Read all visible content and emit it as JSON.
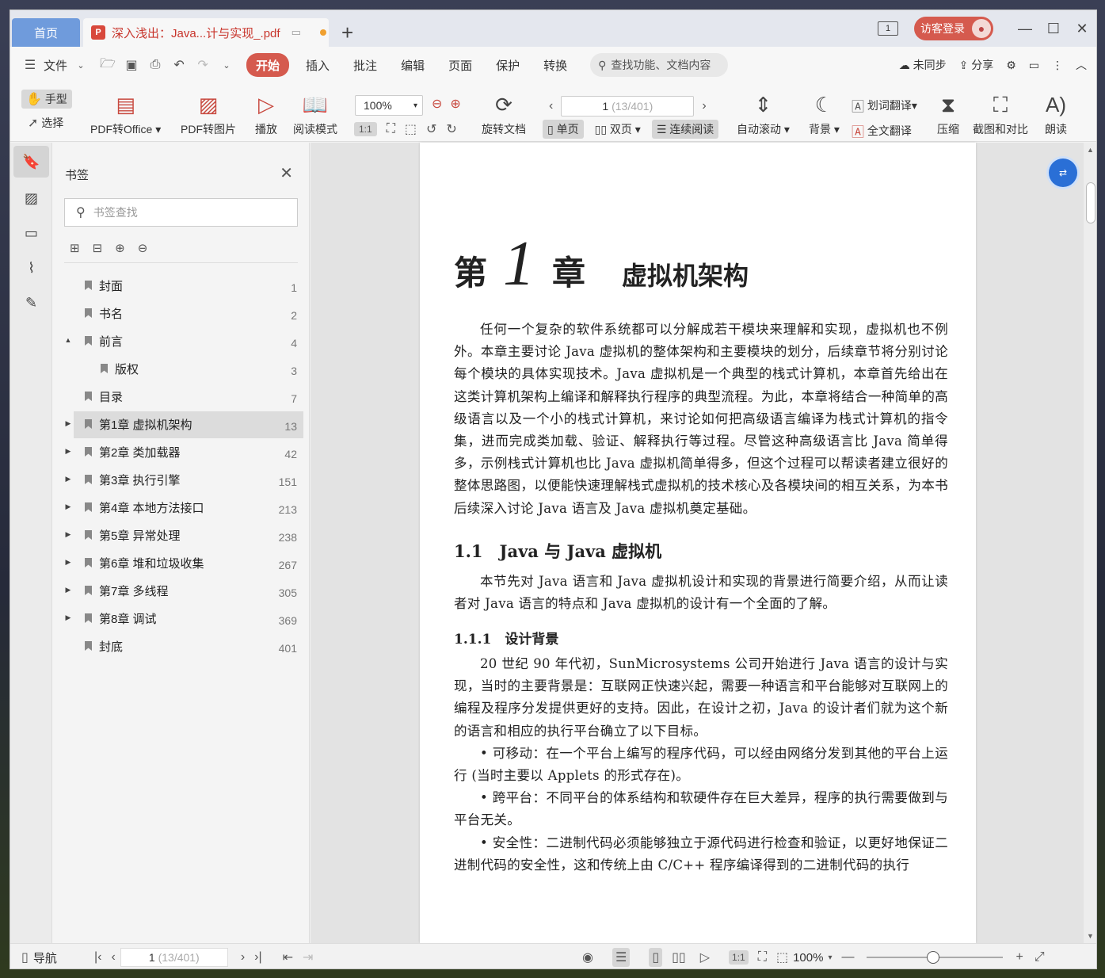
{
  "titlebar": {
    "home_tab": "首页",
    "doc_tab": "深入浅出：Java...计与实现_.pdf",
    "pdf_badge": "P",
    "add_tab": "+",
    "page_indicator": "1",
    "guest_login": "访客登录"
  },
  "menubar": {
    "file": "文件",
    "tabs": [
      "开始",
      "插入",
      "批注",
      "编辑",
      "页面",
      "保护",
      "转换"
    ],
    "search_placeholder": "查找功能、文档内容",
    "sync": "未同步",
    "share": "分享"
  },
  "ribbon": {
    "hand": "手型",
    "select": "选择",
    "pdf_to_office": "PDF转Office",
    "pdf_to_image": "PDF转图片",
    "play": "播放",
    "read_mode": "阅读模式",
    "zoom": "100%",
    "rotate_doc": "旋转文档",
    "page_current": "1",
    "page_total": "(13/401)",
    "single_page": "单页",
    "double_page": "双页",
    "continuous": "连续阅读",
    "auto_scroll": "自动滚动",
    "background": "背景",
    "word_translate": "划词翻译",
    "full_translate": "全文翻译",
    "compress": "压缩",
    "screenshot_compare": "截图和对比",
    "read_aloud": "朗读"
  },
  "bookmarks": {
    "title": "书签",
    "search_placeholder": "书签查找",
    "items": [
      {
        "label": "封面",
        "page": "1"
      },
      {
        "label": "书名",
        "page": "2"
      },
      {
        "label": "前言",
        "page": "4"
      },
      {
        "label": "版权",
        "page": "3"
      },
      {
        "label": "目录",
        "page": "7"
      },
      {
        "label": "第1章 虚拟机架构",
        "page": "13"
      },
      {
        "label": "第2章 类加载器",
        "page": "42"
      },
      {
        "label": "第3章 执行引擎",
        "page": "151"
      },
      {
        "label": "第4章 本地方法接口",
        "page": "213"
      },
      {
        "label": "第5章 异常处理",
        "page": "238"
      },
      {
        "label": "第6章 堆和垃圾收集",
        "page": "267"
      },
      {
        "label": "第7章 多线程",
        "page": "305"
      },
      {
        "label": "第8章 调试",
        "page": "369"
      },
      {
        "label": "封底",
        "page": "401"
      }
    ]
  },
  "document": {
    "chapter_prefix": "第",
    "chapter_num": "1",
    "chapter_suffix": "章",
    "chapter_title": "虚拟机架构",
    "intro": "任何一个复杂的软件系统都可以分解成若干模块来理解和实现，虚拟机也不例外。本章主要讨论 Java 虚拟机的整体架构和主要模块的划分，后续章节将分别讨论每个模块的具体实现技术。Java 虚拟机是一个典型的栈式计算机，本章首先给出在这类计算机架构上编译和解释执行程序的典型流程。为此，本章将结合一种简单的高级语言以及一个小的栈式计算机，来讨论如何把高级语言编译为栈式计算机的指令集，进而完成类加载、验证、解释执行等过程。尽管这种高级语言比 Java 简单得多，示例栈式计算机也比 Java 虚拟机简单得多，但这个过程可以帮读者建立很好的整体思路图，以便能快速理解栈式虚拟机的技术核心及各模块间的相互关系，为本书后续深入讨论 Java 语言及 Java 虚拟机奠定基础。",
    "h_1_1": "1.1　Java 与 Java 虚拟机",
    "p_1_1": "本节先对 Java 语言和 Java 虚拟机设计和实现的背景进行简要介绍，从而让读者对 Java 语言的特点和 Java 虚拟机的设计有一个全面的了解。",
    "h_1_1_1": "1.1.1　设计背景",
    "p_1_1_1": "20 世纪 90 年代初，SunMicrosystems 公司开始进行 Java 语言的设计与实现，当时的主要背景是：互联网正快速兴起，需要一种语言和平台能够对互联网上的编程及程序分发提供更好的支持。因此，在设计之初，Java 的设计者们就为这个新的语言和相应的执行平台确立了以下目标。",
    "b1": "• 可移动：在一个平台上编写的程序代码，可以经由网络分发到其他的平台上运行 (当时主要以 Applets 的形式存在)。",
    "b2": "• 跨平台：不同平台的体系结构和软硬件存在巨大差异，程序的执行需要做到与平台无关。",
    "b3": "• 安全性：二进制代码必须能够独立于源代码进行检查和验证，以更好地保证二进制代码的安全性，这和传统上由 C/C++ 程序编译得到的二进制代码的执行"
  },
  "statusbar": {
    "nav": "导航",
    "page_current": "1",
    "page_total": "(13/401)",
    "zoom": "100%"
  },
  "colors": {
    "accent": "#d55a4e",
    "home_tab": "#6f9bdc",
    "float_button": "#2a6fd6"
  }
}
